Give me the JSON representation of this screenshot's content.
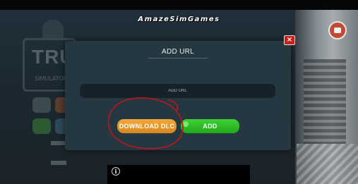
{
  "watermark": "AmazeSimGames",
  "dialog": {
    "title": "ADD URL",
    "close_label": "×",
    "url_placeholder": "ADD URL",
    "url_value": "",
    "download_label": "DOWNLOAD DLC",
    "add_label": "ADD"
  },
  "ad": {
    "info_label": "i"
  },
  "colors": {
    "download_button": "#e39a2a",
    "add_button": "#2fbd26",
    "close_button": "#c8211a",
    "dialog_bg": "#253740",
    "annotation": "#c0151a"
  },
  "icons": {
    "top_right": "chat-icon",
    "close": "close-icon",
    "ad": "info-icon"
  }
}
